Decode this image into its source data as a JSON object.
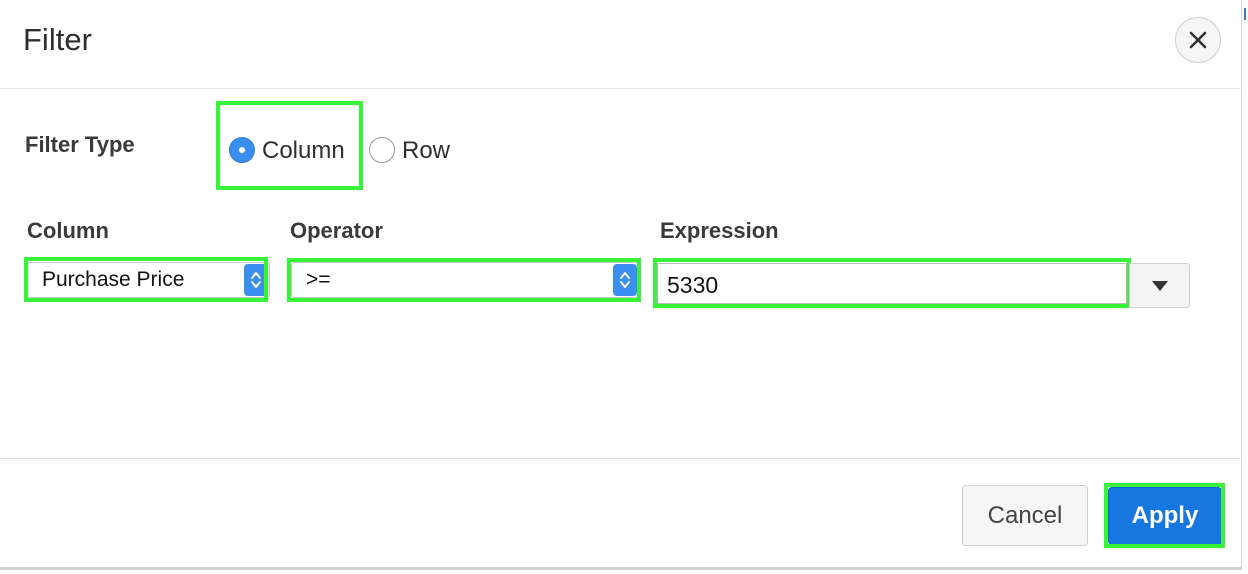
{
  "dialog": {
    "title": "Filter",
    "close_icon": "close-icon"
  },
  "filter_type": {
    "label": "Filter Type",
    "options": [
      {
        "label": "Column",
        "selected": true
      },
      {
        "label": "Row",
        "selected": false
      }
    ]
  },
  "fields": {
    "column": {
      "label": "Column",
      "value": "Purchase Price"
    },
    "operator": {
      "label": "Operator",
      "value": ">="
    },
    "expression": {
      "label": "Expression",
      "value": "5330",
      "dropdown_icon": "triangle-down-icon"
    }
  },
  "footer": {
    "cancel_label": "Cancel",
    "apply_label": "Apply"
  },
  "colors": {
    "accent": "#1777e0",
    "radio_selected": "#3a8ef0",
    "highlight": "#39f33a"
  }
}
